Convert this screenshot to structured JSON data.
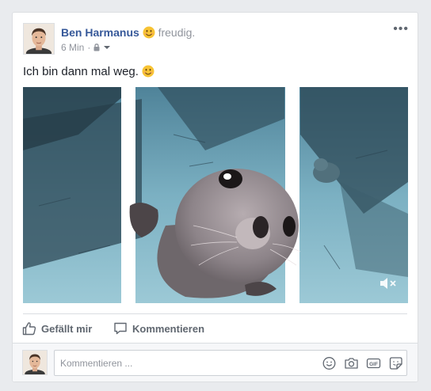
{
  "post": {
    "author_name": "Ben Harmanus",
    "feeling_text": "freudig.",
    "timestamp": "6 Min",
    "meta_separator": "·",
    "privacy_icon": "lock-icon",
    "text": "Ich bin dann mal weg.",
    "text_emoji_icon": "smiley-face-icon",
    "more_icon": "ellipsis-icon",
    "more_label": "•••"
  },
  "media": {
    "type": "animated-gif",
    "description_icon": "mute-icon"
  },
  "actions": {
    "like_label": "Gefällt mir",
    "like_icon": "thumbs-up-icon",
    "comment_label": "Kommentieren",
    "comment_icon": "speech-bubble-icon"
  },
  "comment_composer": {
    "placeholder": "Kommentieren ...",
    "value": "",
    "tools": [
      "emoji-icon",
      "camera-icon",
      "gif-icon",
      "sticker-icon"
    ],
    "gif_label": "GIF"
  },
  "colors": {
    "author_link": "#365899",
    "secondary_text": "#90949c",
    "action_text": "#606770",
    "background": "#e9ebee"
  }
}
